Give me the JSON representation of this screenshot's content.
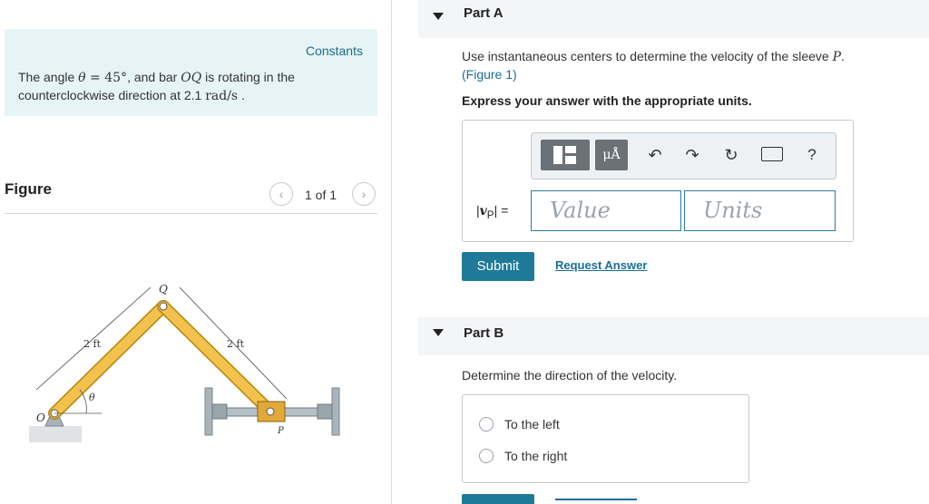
{
  "constants": {
    "title": "Constants",
    "text_pre": "The angle ",
    "theta": "θ",
    "eq": " = 45°",
    "text_mid": ", and bar ",
    "bar_name": "OQ",
    "text_post": " is rotating in the counterclockwise direction at 2.1 ",
    "unit": "rad/s",
    "end": " ."
  },
  "figure": {
    "label": "Figure",
    "pager": "1 of 1",
    "prev_icon": "chevron-left-icon",
    "next_icon": "chevron-right-icon",
    "labels": {
      "Q": "Q",
      "O": "O",
      "theta": "θ",
      "P": "P",
      "len_left": "2 ft",
      "len_right": "2 ft"
    }
  },
  "partA": {
    "title": "Part A",
    "question_pre": "Use instantaneous centers to determine the velocity of the sleeve ",
    "question_var": "P",
    "question_post": ".",
    "figure_link": "(Figure 1)",
    "instruction": "Express your answer with the appropriate units.",
    "toolbar": {
      "templates_icon": "templates-icon",
      "units_button": "μÅ",
      "undo_icon": "undo-icon",
      "redo_icon": "redo-icon",
      "reset_icon": "reset-icon",
      "keyboard_icon": "keyboard-icon",
      "help": "?"
    },
    "answer_label_var": "v",
    "answer_label_sub": "P",
    "answer_label_eq": " =",
    "value_placeholder": "Value",
    "units_placeholder": "Units",
    "submit": "Submit",
    "request_answer": "Request Answer"
  },
  "partB": {
    "title": "Part B",
    "question": "Determine the direction of the velocity.",
    "options": [
      "To the left",
      "To the right"
    ]
  },
  "colors": {
    "accent": "#1f7a99",
    "constants_bg": "#e6f4f6",
    "bar_fill": "#f2c14e"
  }
}
